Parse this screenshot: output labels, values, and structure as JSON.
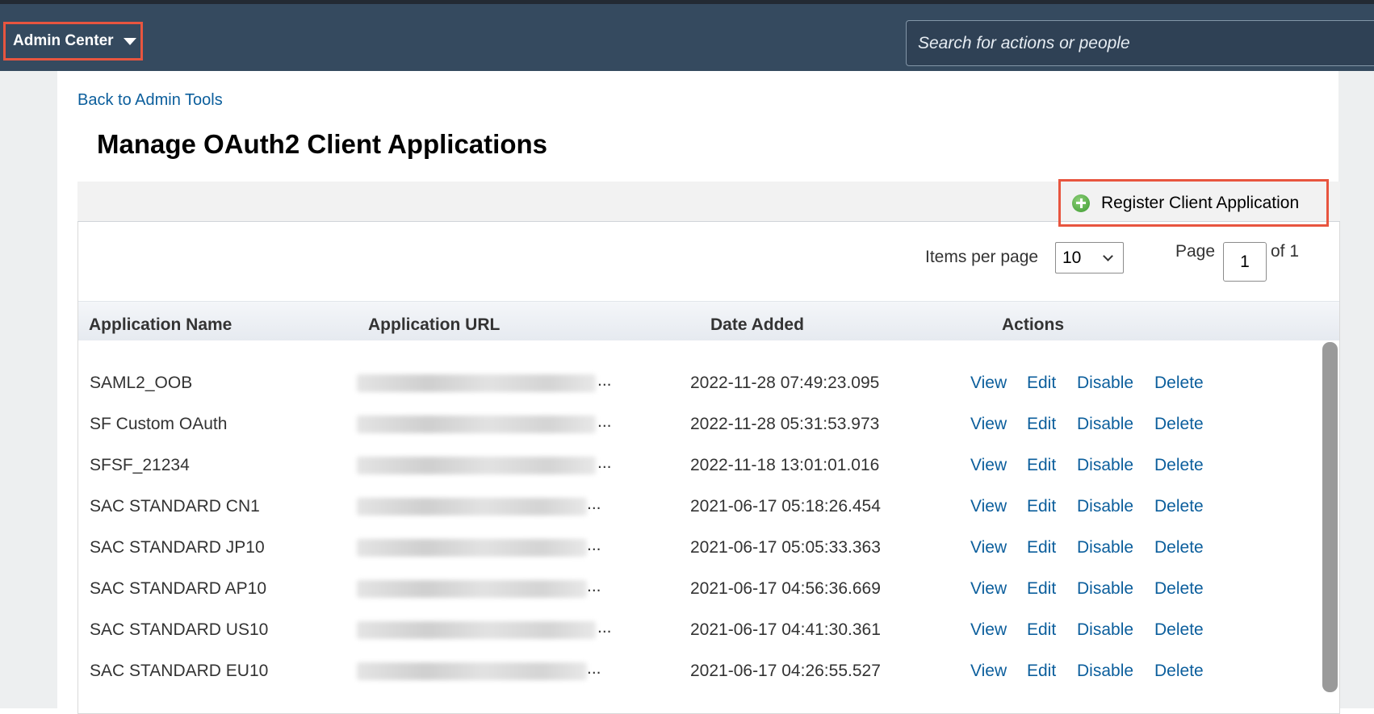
{
  "shellbar": {
    "admin_center": "Admin Center",
    "search_placeholder": "Search for actions or people"
  },
  "back_link": "Back to Admin Tools",
  "page_title": "Manage OAuth2 Client Applications",
  "toolbar": {
    "register_label": "Register Client Application"
  },
  "pagination": {
    "items_per_page_label": "Items per page",
    "items_per_page_value": "10",
    "page_label": "Page",
    "page_value": "1",
    "of_label": "of 1"
  },
  "table": {
    "columns": [
      "Application Name",
      "Application URL",
      "Date Added",
      "Actions"
    ],
    "rows": [
      {
        "name": "SAML2_OOB",
        "date": "2022-11-28 07:49:23.095"
      },
      {
        "name": "SF Custom OAuth",
        "date": "2022-11-28 05:31:53.973"
      },
      {
        "name": "SFSF_21234",
        "date": "2022-11-18 13:01:01.016"
      },
      {
        "name": "SAC STANDARD CN1",
        "date": "2021-06-17 05:18:26.454"
      },
      {
        "name": "SAC STANDARD JP10",
        "date": "2021-06-17 05:05:33.363"
      },
      {
        "name": "SAC STANDARD AP10",
        "date": "2021-06-17 04:56:36.669"
      },
      {
        "name": "SAC STANDARD US10",
        "date": "2021-06-17 04:41:30.361"
      },
      {
        "name": "SAC STANDARD EU10",
        "date": "2021-06-17 04:26:55.527"
      }
    ],
    "url_ellipsis": "...",
    "actions": {
      "view": "View",
      "edit": "Edit",
      "disable": "Disable",
      "delete": "Delete"
    }
  },
  "colors": {
    "shellbar": "#354a5f",
    "highlight": "#e8553f",
    "link": "#0b5e9c"
  }
}
